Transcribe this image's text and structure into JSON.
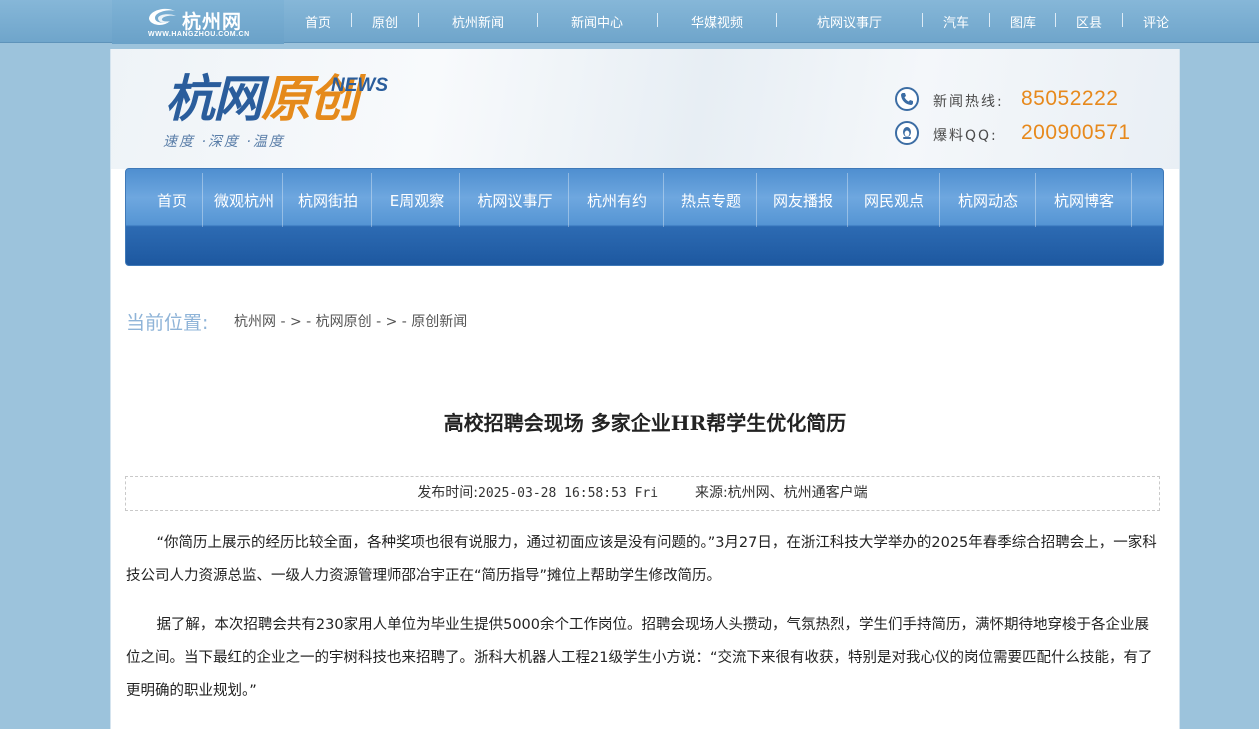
{
  "site": {
    "logo_name": "杭州网",
    "logo_url": "WWW.HANGZHOU.COM.CN"
  },
  "global_nav": [
    "首页",
    "原创",
    "杭州新闻",
    "新闻中心",
    "华媒视频",
    "杭网议事厅",
    "汽车",
    "图库",
    "区县",
    "评论"
  ],
  "header": {
    "brand_part1": "杭网",
    "brand_part2": "原创",
    "brand_news": "NEWS",
    "slogan": "速度 ·深度 ·温度",
    "hotline_label": "新闻热线:",
    "hotline_value": "85052222",
    "qq_label": "爆料QQ:",
    "qq_value": "200900571"
  },
  "main_nav": [
    "首页",
    "微观杭州",
    "杭网街拍",
    "E周观察",
    "杭网议事厅",
    "杭州有约",
    "热点专题",
    "网友播报",
    "网民观点",
    "杭网动态",
    "杭网博客"
  ],
  "breadcrumb": {
    "label": "当前位置:",
    "items": [
      "杭州网",
      "杭网原创",
      "原创新闻"
    ],
    "separator": " - > - "
  },
  "article": {
    "title": "高校招聘会现场 多家企业HR帮学生优化简历",
    "time_label": "发布时间:",
    "time_value": "2025-03-28 16:58:53 Fri",
    "source_label": "来源:",
    "source_value": "杭州网、杭州通客户端",
    "paragraphs": [
      "“你简历上展示的经历比较全面，各种奖项也很有说服力，通过初面应该是没有问题的。”3月27日，在浙江科技大学举办的2025年春季综合招聘会上，一家科技公司人力资源总监、一级人力资源管理师邵冶宇正在“简历指导”摊位上帮助学生修改简历。",
      "据了解，本次招聘会共有230家用人单位为毕业生提供5000余个工作岗位。招聘会现场人头攒动，气氛热烈，学生们手持简历，满怀期待地穿梭于各企业展位之间。当下最红的企业之一的宇树科技也来招聘了。浙科大机器人工程21级学生小方说：“交流下来很有收获，特别是对我心仪的岗位需要匹配什么技能，有了更明确的职业规划。”"
    ]
  }
}
